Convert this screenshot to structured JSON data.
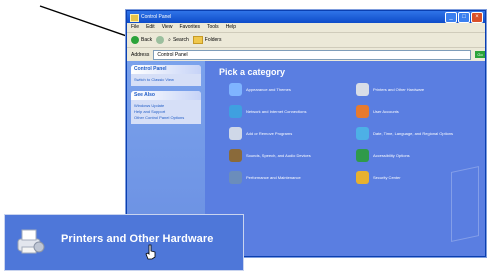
{
  "window": {
    "title": "Control Panel",
    "menu": [
      "File",
      "Edit",
      "View",
      "Favorites",
      "Tools",
      "Help"
    ],
    "toolbar": {
      "back": "Back",
      "search": "Search",
      "folders": "Folders"
    },
    "address": {
      "label": "Address",
      "value": "Control Panel",
      "go": "Go"
    }
  },
  "sidebar": {
    "control_panel_head": "Control Panel",
    "switch_view": "Switch to Classic View",
    "see_also_head": "See Also",
    "see_also_items": [
      "Windows Update",
      "Help and Support",
      "Other Control Panel Options"
    ]
  },
  "main": {
    "heading": "Pick a category",
    "categories": [
      {
        "label": "Appearance and Themes",
        "color": "#7fb4ff",
        "icon": "appearance-icon"
      },
      {
        "label": "Printers and Other Hardware",
        "color": "#d8dde7",
        "icon": "printer-icon"
      },
      {
        "label": "Network and Internet Connections",
        "color": "#3fa0e0",
        "icon": "network-icon"
      },
      {
        "label": "User Accounts",
        "color": "#e87a2e",
        "icon": "users-icon"
      },
      {
        "label": "Add or Remove Programs",
        "color": "#cfd8e8",
        "icon": "programs-icon"
      },
      {
        "label": "Date, Time, Language, and Regional Options",
        "color": "#4db0e6",
        "icon": "clock-globe-icon"
      },
      {
        "label": "Sounds, Speech, and Audio Devices",
        "color": "#8a6a3a",
        "icon": "sound-icon"
      },
      {
        "label": "Accessibility Options",
        "color": "#2f9a4a",
        "icon": "accessibility-icon"
      },
      {
        "label": "Performance and Maintenance",
        "color": "#6b8dbb",
        "icon": "performance-icon"
      },
      {
        "label": "Security Center",
        "color": "#e7b12f",
        "icon": "shield-icon"
      }
    ]
  },
  "zoom": {
    "label": "Printers and Other Hardware"
  }
}
